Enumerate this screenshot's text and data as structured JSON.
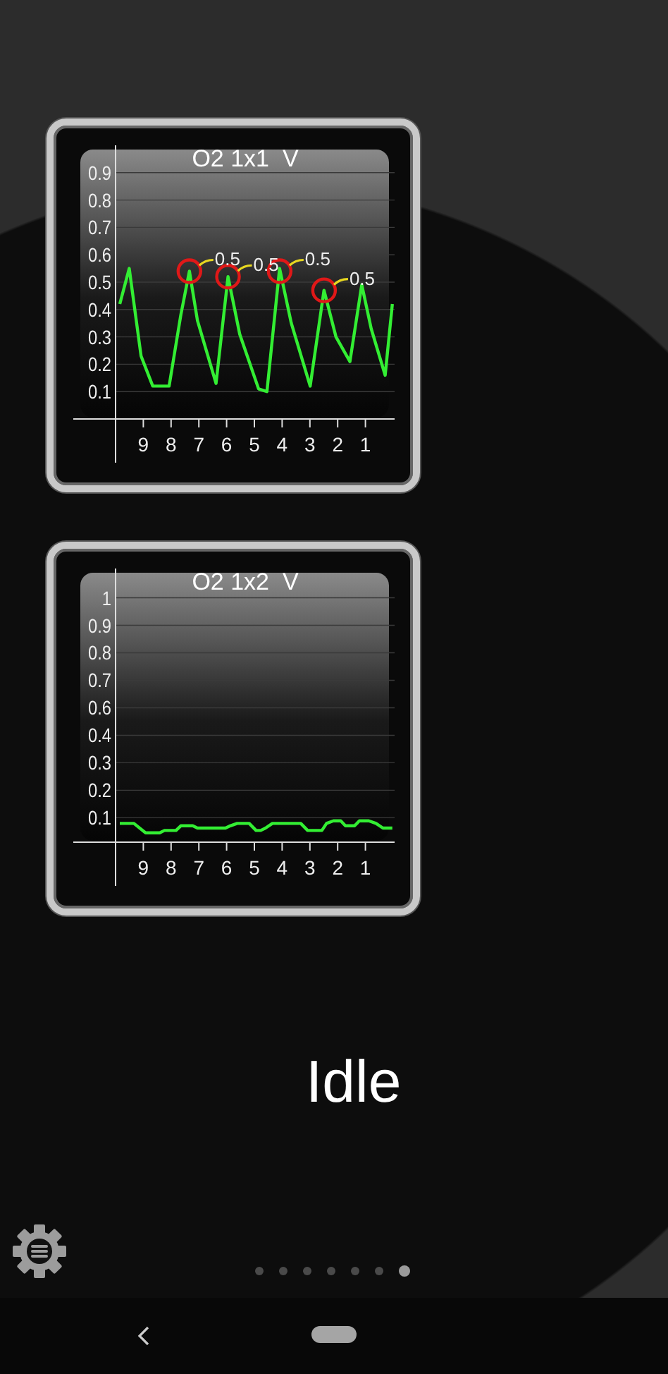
{
  "charts": [
    {
      "chart_data": {
        "type": "line",
        "title": "O2 1x1  V",
        "xlim": [
          10,
          0
        ],
        "ylim": [
          0,
          1
        ],
        "xticks": [
          9,
          8,
          7,
          6,
          5,
          4,
          3,
          2,
          1
        ],
        "yticks": [
          0.1,
          0.2,
          0.3,
          0.4,
          0.5,
          0.6,
          0.7,
          0.8,
          0.9
        ],
        "grid": true,
        "x": [
          9.85,
          9.51,
          9.08,
          8.66,
          8.07,
          7.65,
          7.34,
          7.05,
          6.38,
          5.95,
          5.53,
          4.85,
          4.55,
          4.09,
          3.67,
          2.99,
          2.49,
          2.06,
          1.56,
          1.13,
          0.79,
          0.29,
          0.03
        ],
        "series": [
          {
            "color": "#33ee33",
            "values": [
              0.42,
              0.55,
              0.23,
              0.12,
              0.12,
              0.38,
              0.54,
              0.36,
              0.13,
              0.52,
              0.31,
              0.11,
              0.1,
              0.55,
              0.35,
              0.12,
              0.47,
              0.3,
              0.21,
              0.49,
              0.33,
              0.16,
              0.42
            ]
          }
        ],
        "annotations": [
          {
            "x": 7.34,
            "y": 0.54,
            "text": "0.5"
          },
          {
            "x": 5.95,
            "y": 0.52,
            "text": "0.5"
          },
          {
            "x": 4.09,
            "y": 0.54,
            "text": "0.5"
          },
          {
            "x": 2.49,
            "y": 0.47,
            "text": "0.5"
          }
        ]
      }
    },
    {
      "chart_data": {
        "type": "line",
        "title": "O2 1x2  V",
        "xlim": [
          10,
          0
        ],
        "ylim": [
          0,
          1.12
        ],
        "xticks": [
          9,
          8,
          7,
          6,
          5,
          4,
          3,
          2,
          1
        ],
        "yticks": [
          0.1,
          {
            "value": 0.2125,
            "label": "0.2"
          },
          {
            "value": 0.325,
            "label": "0.3"
          },
          {
            "value": 0.4375,
            "label": "0.4"
          },
          {
            "value": 0.55,
            "label": "0.6"
          },
          {
            "value": 0.6625,
            "label": "0.7"
          },
          {
            "value": 0.775,
            "label": "0.8"
          },
          {
            "value": 0.8875,
            "label": "0.9"
          },
          1
        ],
        "grid": true,
        "x": [
          9.85,
          9.34,
          8.92,
          8.41,
          8.24,
          7.82,
          7.65,
          7.22,
          7.05,
          6.04,
          5.87,
          5.62,
          5.19,
          4.94,
          4.77,
          4.6,
          4.35,
          3.33,
          3.08,
          2.57,
          2.4,
          2.15,
          1.89,
          1.72,
          1.39,
          1.22,
          0.88,
          0.62,
          0.37,
          0.03
        ],
        "series": [
          {
            "color": "#33ee33",
            "values": [
              0.077,
              0.077,
              0.038,
              0.038,
              0.048,
              0.048,
              0.067,
              0.067,
              0.058,
              0.058,
              0.067,
              0.077,
              0.077,
              0.048,
              0.048,
              0.058,
              0.077,
              0.077,
              0.048,
              0.048,
              0.077,
              0.087,
              0.087,
              0.067,
              0.067,
              0.087,
              0.087,
              0.077,
              0.058,
              0.058
            ]
          }
        ]
      }
    }
  ],
  "status": "Idle",
  "pages": [
    {
      "selected": false
    },
    {
      "selected": false
    },
    {
      "selected": false
    },
    {
      "selected": false
    },
    {
      "selected": false
    },
    {
      "selected": false
    },
    {
      "selected": true
    }
  ]
}
